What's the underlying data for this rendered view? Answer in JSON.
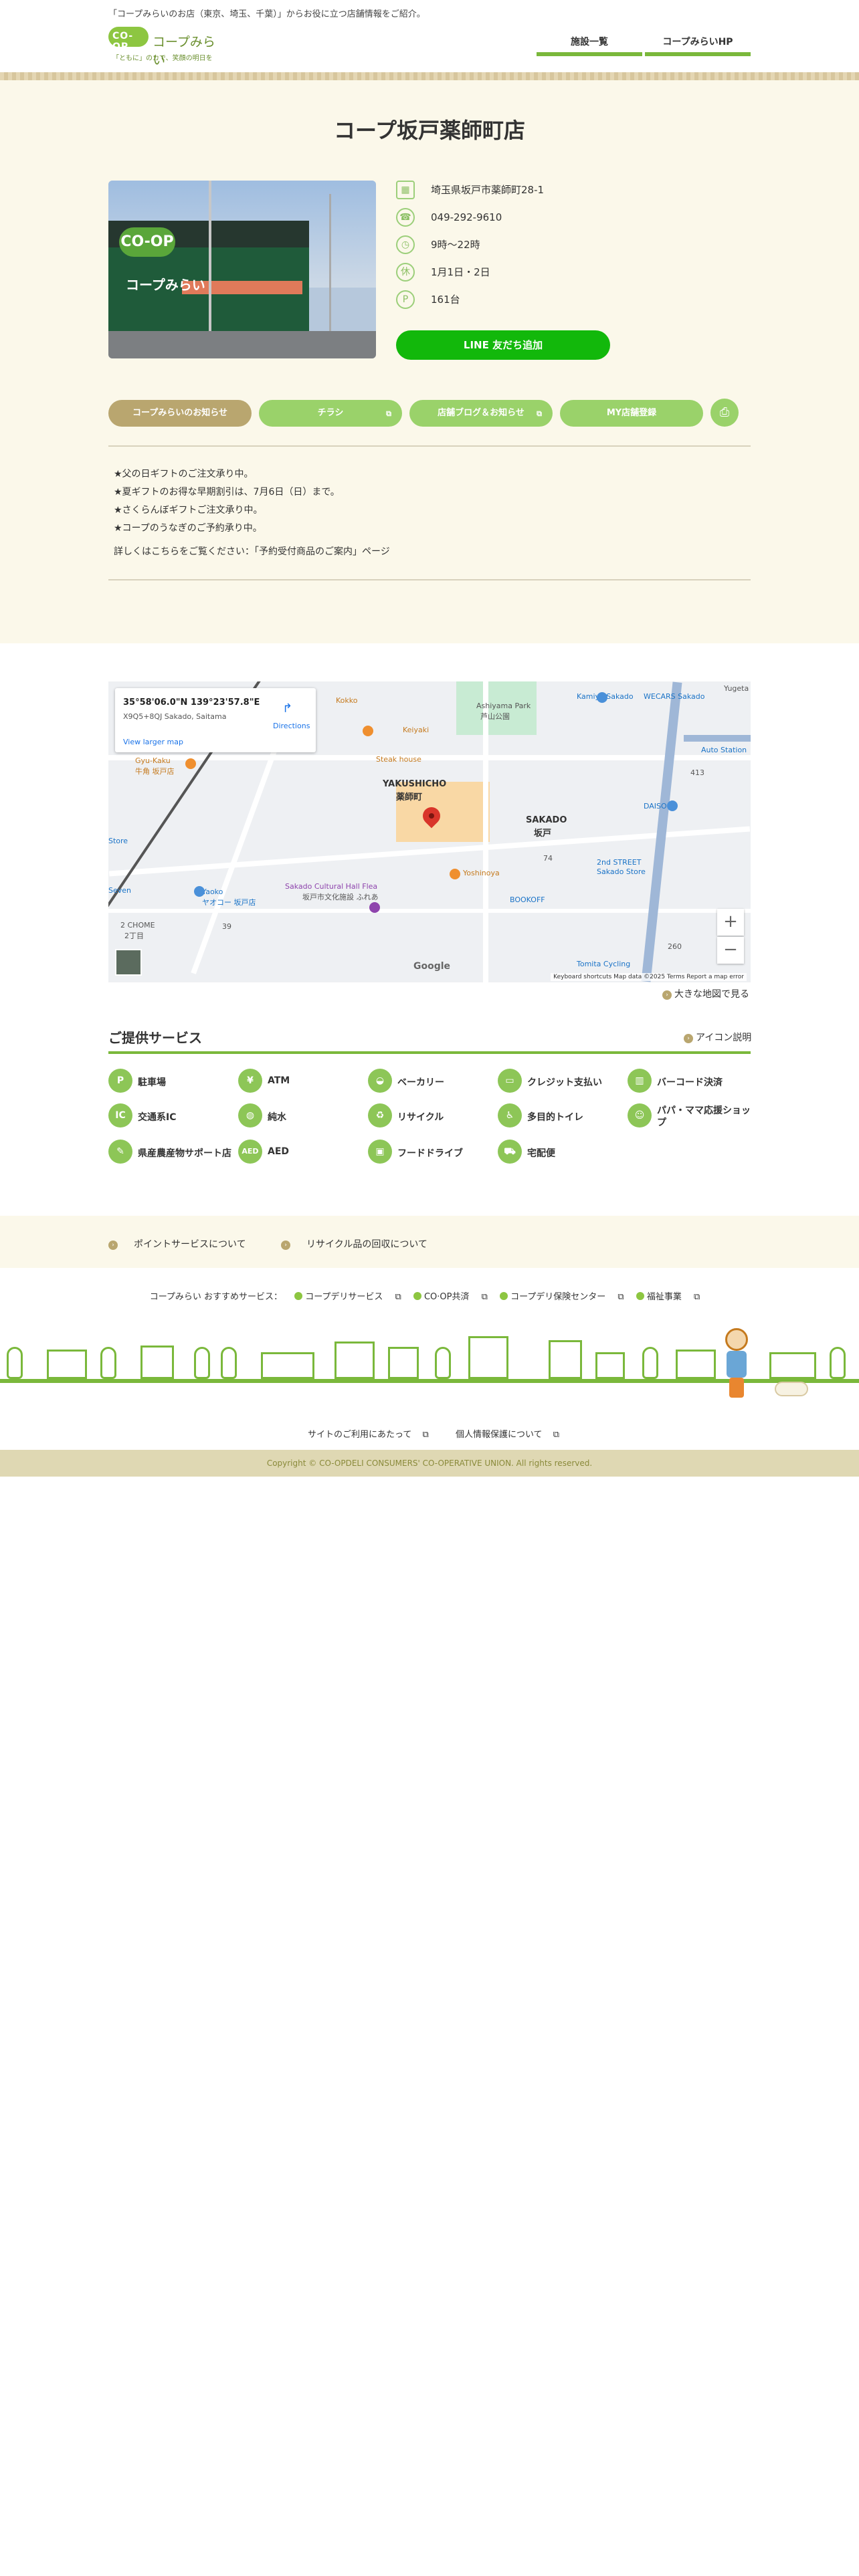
{
  "header": {
    "tagline": "「コープみらいのお店（東京、埼玉、千葉）」からお役に立つ店舗情報をご紹介。",
    "logo_mark": "CO-OP",
    "logo_name": "コープみらい",
    "logo_sub": "「ともに」のカで、笑顔の明日を",
    "nav": [
      "施設一覧",
      "コープみらいHP"
    ]
  },
  "store": {
    "name": "コープ坂戸薬師町店",
    "photo_sign": "CO-OP",
    "photo_shop": "コープみらい",
    "info": [
      {
        "icon": "building-icon",
        "glyph": "▦",
        "text": "埼玉県坂戸市薬師町28-1"
      },
      {
        "icon": "phone-icon",
        "glyph": "☎",
        "text": "049-292-9610"
      },
      {
        "icon": "clock-icon",
        "glyph": "◷",
        "text": "9時〜22時"
      },
      {
        "icon": "holiday-icon",
        "glyph": "休",
        "text": "1月1日・2日"
      },
      {
        "icon": "parking-icon",
        "glyph": "P",
        "text": "161台"
      }
    ],
    "line_button": "LINE 友だち追加"
  },
  "tabs": [
    "コープみらいのお知らせ",
    "チラシ",
    "店舗ブログ＆お知らせ",
    "MY店舗登録"
  ],
  "news": {
    "lines": [
      "★父の日ギフトのご注文承り中。",
      "★夏ギフトのお得な早期割引は、7月6日（日）まで。",
      "★さくらんぼギフトご注文承り中。",
      "★コープのうなぎのご予約承り中。"
    ],
    "more": "詳しくはこちらをご覧ください：「予約受付商品のご案内」ページ"
  },
  "map": {
    "coords": "35°58'06.0\"N 139°23'57.8\"E",
    "plus_code": "X9Q5+8QJ Sakado, Saitama",
    "directions": "Directions",
    "larger": "View larger map",
    "labels": {
      "kokko": "Kokko",
      "ashiyama": "Ashiyama Park",
      "ashiyama_jp": "芦山公園",
      "kamiya": "Kamiya Sakado",
      "wecars": "WECARS Sakado",
      "keiyaki": "Keiyaki",
      "steak": "Steak house",
      "yugeta": "Yugeta",
      "auto": "Auto Station",
      "gyukaku": "Gyu-Kaku",
      "gyukaku_jp": "牛角 坂戸店",
      "yakushicho": "YAKUSHICHO",
      "yakushicho_jp": "薬師町",
      "sakado": "SAKADO",
      "sakado_jp": "坂戸",
      "daiso": "DAISO",
      "store_l": "Store",
      "yoshinoya": "Yoshinoya",
      "second_street": "2nd STREET",
      "second_street2": "Sakado Store",
      "bookoff": "BOOKOFF",
      "cultural": "Sakado Cultural Hall Flea",
      "cultural_jp": "坂戸市文化施設 ふれあ",
      "yaoko": "Yaoko",
      "yaoko_jp": "ヤオコー 坂戸店",
      "seven": "Seven",
      "chome": "2 CHOME",
      "chome_jp": "2丁目",
      "tomita": "Tomita Cycling",
      "road_413": "413",
      "road_74": "74",
      "road_39": "39",
      "road_260": "260"
    },
    "google": "Google",
    "footer": "Keyboard shortcuts   Map data ©2025   Terms   Report a map error",
    "zoom_in": "+",
    "zoom_out": "−"
  },
  "big_map_link": "大きな地図で見る",
  "services": {
    "title": "ご提供サービス",
    "icon_legend": "アイコン説明",
    "items": [
      {
        "label": "駐車場",
        "glyph": "P",
        "icon": "parking-icon"
      },
      {
        "label": "ATM",
        "glyph": "¥",
        "icon": "atm-icon"
      },
      {
        "label": "ベーカリー",
        "glyph": "◒",
        "icon": "bakery-icon"
      },
      {
        "label": "クレジット支払い",
        "glyph": "▭",
        "icon": "credit-card-icon"
      },
      {
        "label": "バーコード決済",
        "glyph": "▥",
        "icon": "barcode-icon"
      },
      {
        "label": "交通系IC",
        "glyph": "IC",
        "icon": "ic-card-icon"
      },
      {
        "label": "純水",
        "glyph": "◍",
        "icon": "water-icon"
      },
      {
        "label": "リサイクル",
        "glyph": "♻",
        "icon": "recycle-icon"
      },
      {
        "label": "多目的トイレ",
        "glyph": "♿",
        "icon": "toilet-icon"
      },
      {
        "label": "パパ・ママ応援ショップ",
        "glyph": "☺",
        "icon": "parents-icon"
      },
      {
        "label": "県産農産物サポート店",
        "glyph": "✎",
        "icon": "farm-icon"
      },
      {
        "label": "AED",
        "glyph": "AED",
        "icon": "aed-icon"
      },
      {
        "label": "フードドライブ",
        "glyph": "▣",
        "icon": "food-drive-icon"
      },
      {
        "label": "宅配便",
        "glyph": "⛟",
        "icon": "delivery-icon"
      }
    ]
  },
  "footer": {
    "links": [
      "ポイントサービスについて",
      "リサイクル品の回収について"
    ],
    "recommend_label": "コープみらい おすすめサービス：",
    "recommend": [
      "コープデリサービス",
      "CO·OP共済",
      "コープデリ保険センター",
      "福祉事業"
    ],
    "legal": [
      "サイトのご利用にあたって",
      "個人情報保護について"
    ],
    "copyright": "Copyright © CO-OPDELI CONSUMERS' CO-OPERATIVE UNION. All rights reserved."
  },
  "colors": {
    "accent": "#7ab83b",
    "tab_active": "#b9a66f",
    "line_green": "#12b80b",
    "bg_cream": "#fbf8ea"
  }
}
